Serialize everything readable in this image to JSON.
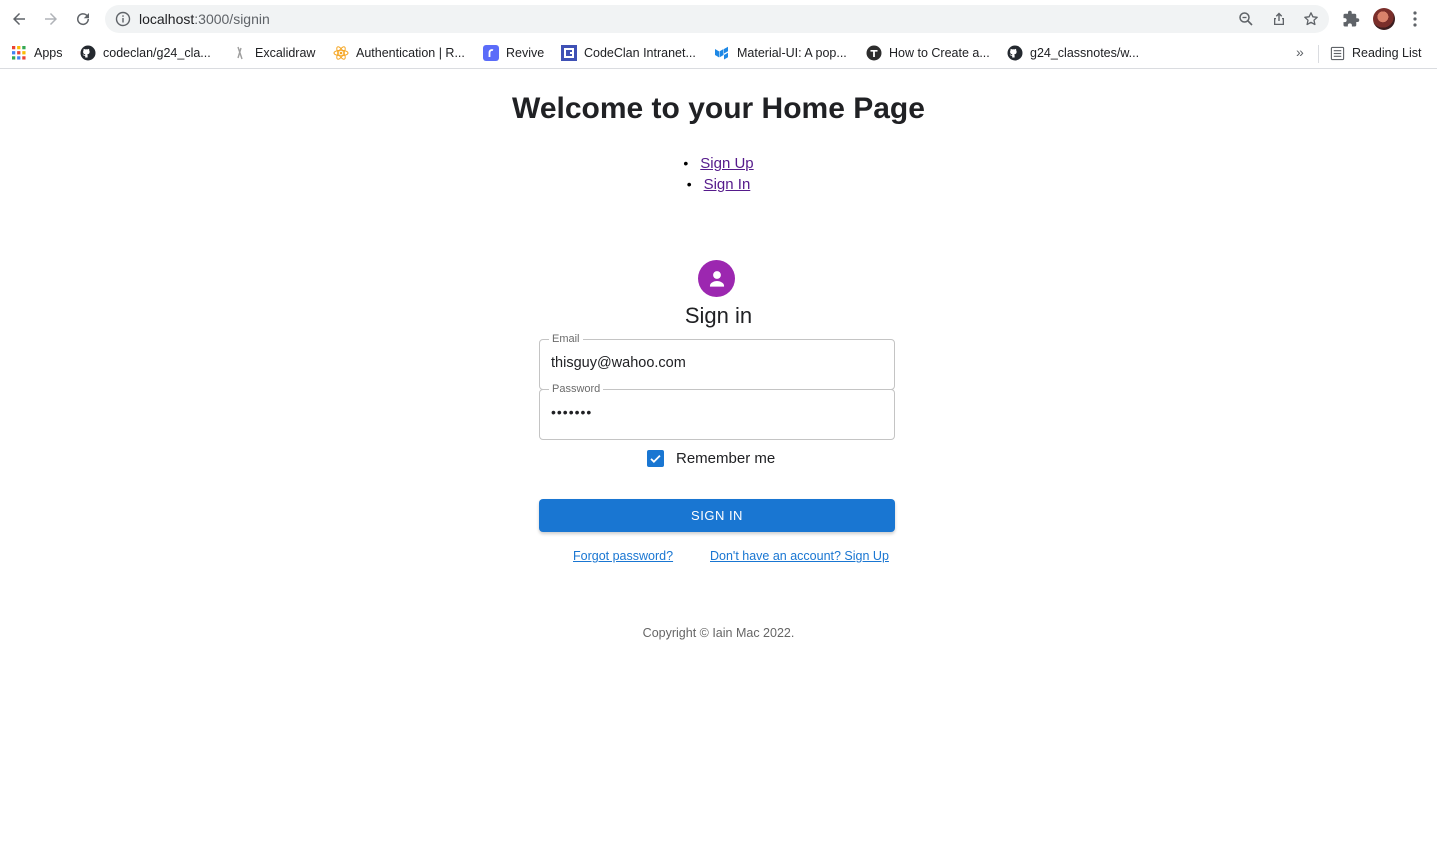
{
  "browser": {
    "url_host": "localhost",
    "url_path": ":3000/signin",
    "icons": {
      "back": "back-arrow-icon",
      "forward": "forward-arrow-icon",
      "reload": "reload-icon",
      "info": "info-icon",
      "zoom": "zoom-icon",
      "share": "share-icon",
      "star": "bookmark-star-icon",
      "extensions": "puzzle-icon",
      "menu": "kebab-menu-icon"
    },
    "bookmarks": [
      {
        "label": "Apps",
        "icon": "apps-grid-icon"
      },
      {
        "label": "codeclan/g24_cla...",
        "icon": "github-icon"
      },
      {
        "label": "Excalidraw",
        "icon": "excalidraw-icon"
      },
      {
        "label": "Authentication | R...",
        "icon": "react-icon"
      },
      {
        "label": "Revive",
        "icon": "revive-icon"
      },
      {
        "label": "CodeClan Intranet...",
        "icon": "codeclan-icon"
      },
      {
        "label": "Material-UI: A pop...",
        "icon": "material-ui-icon"
      },
      {
        "label": "How to Create a...",
        "icon": "site-icon"
      },
      {
        "label": "g24_classnotes/w...",
        "icon": "github-icon"
      }
    ],
    "more_bookmarks": "»",
    "reading_list": "Reading List"
  },
  "page": {
    "heading": "Welcome to your Home Page",
    "nav_links": [
      "Sign Up",
      "Sign In"
    ],
    "form": {
      "title": "Sign in",
      "email_label": "Email",
      "email_value": "thisguy@wahoo.com",
      "password_label": "Password",
      "password_value": "•••••••",
      "remember_label": "Remember me",
      "remember_checked": true,
      "submit_label": "SIGN IN",
      "forgot_link": "Forgot password?",
      "signup_link": "Don't have an account? Sign Up"
    },
    "copyright": "Copyright © Iain Mac 2022."
  },
  "colors": {
    "primary": "#1976d2",
    "avatar": "#9c27b0",
    "visited_link": "#551a8b"
  }
}
